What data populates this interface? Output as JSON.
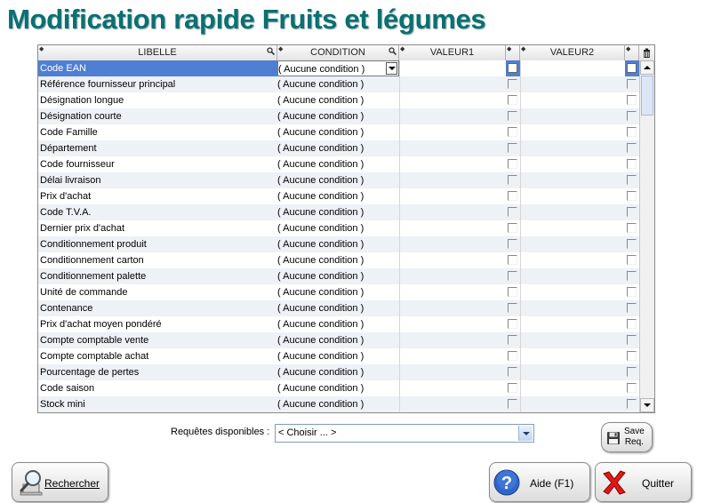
{
  "title": "Modification rapide Fruits et légumes",
  "grid": {
    "headers": {
      "libelle": "LIBELLE",
      "condition": "CONDITION",
      "valeur1": "VALEUR1",
      "valeur2": "VALEUR2"
    },
    "condition_default": "( Aucune condition )",
    "rows": [
      {
        "libelle": "Code EAN",
        "condition": "( Aucune condition )"
      },
      {
        "libelle": "Référence fournisseur principal",
        "condition": "( Aucune condition )"
      },
      {
        "libelle": "Désignation longue",
        "condition": "( Aucune condition )"
      },
      {
        "libelle": "Désignation courte",
        "condition": "( Aucune condition )"
      },
      {
        "libelle": "Code Famille",
        "condition": "( Aucune condition )"
      },
      {
        "libelle": "Département",
        "condition": "( Aucune condition )"
      },
      {
        "libelle": "Code fournisseur",
        "condition": "( Aucune condition )"
      },
      {
        "libelle": "Délai livraison",
        "condition": "( Aucune condition )"
      },
      {
        "libelle": "Prix d'achat",
        "condition": "( Aucune condition )"
      },
      {
        "libelle": "Code T.V.A.",
        "condition": "( Aucune condition )"
      },
      {
        "libelle": "Dernier prix d'achat",
        "condition": "( Aucune condition )"
      },
      {
        "libelle": "Conditionnement produit",
        "condition": "( Aucune condition )"
      },
      {
        "libelle": "Conditionnement carton",
        "condition": "( Aucune condition )"
      },
      {
        "libelle": "Conditionnement palette",
        "condition": "( Aucune condition )"
      },
      {
        "libelle": "Unité de commande",
        "condition": "( Aucune condition )"
      },
      {
        "libelle": "Contenance",
        "condition": "( Aucune condition )"
      },
      {
        "libelle": "Prix d'achat moyen pondéré",
        "condition": "( Aucune condition )"
      },
      {
        "libelle": "Compte comptable vente",
        "condition": "( Aucune condition )"
      },
      {
        "libelle": "Compte comptable achat",
        "condition": "( Aucune condition )"
      },
      {
        "libelle": "Pourcentage de pertes",
        "condition": "( Aucune condition )"
      },
      {
        "libelle": "Code saison",
        "condition": "( Aucune condition )"
      },
      {
        "libelle": "Stock mini",
        "condition": "( Aucune condition )"
      }
    ],
    "selected_row": 0
  },
  "requetes": {
    "label": "Requêtes disponibles :",
    "value": "< Choisir ... >"
  },
  "buttons": {
    "save": "Save\nReq.",
    "rechercher": "Rechercher",
    "aide": "Aide (F1)",
    "quitter": "Quitter"
  },
  "colors": {
    "title": "#0a7070",
    "selection": "#4f7fd3"
  }
}
